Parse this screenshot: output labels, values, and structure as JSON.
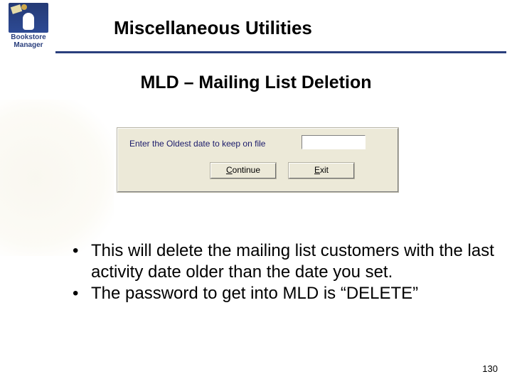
{
  "logo": {
    "line1": "Bookstore",
    "line2": "Manager"
  },
  "title": "Miscellaneous Utilities",
  "subtitle": "MLD – Mailing List Deletion",
  "dialog": {
    "prompt": "Enter the Oldest date to keep on file",
    "input_value": "",
    "continue_label": "Continue",
    "exit_label": "Exit"
  },
  "bullets": [
    "This will delete the mailing list customers with the last activity date older than the date you set.",
    "The password to get into MLD is “DELETE”"
  ],
  "page_number": "130"
}
